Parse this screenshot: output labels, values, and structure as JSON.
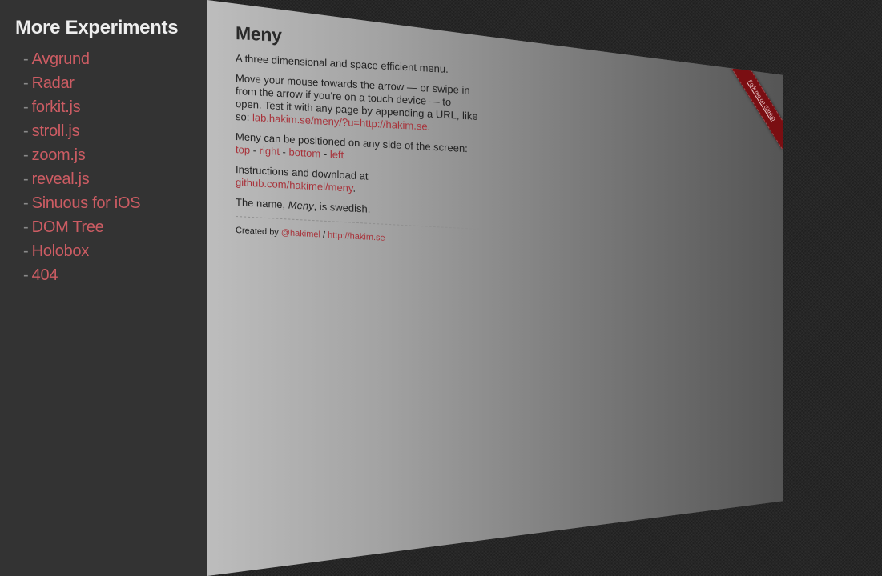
{
  "menu": {
    "title": "More Experiments",
    "dash": "-",
    "items": [
      {
        "label": "Avgrund"
      },
      {
        "label": "Radar"
      },
      {
        "label": "forkit.js"
      },
      {
        "label": "stroll.js"
      },
      {
        "label": "zoom.js"
      },
      {
        "label": "reveal.js"
      },
      {
        "label": "Sinuous for iOS"
      },
      {
        "label": "DOM Tree"
      },
      {
        "label": "Holobox"
      },
      {
        "label": "404"
      }
    ]
  },
  "panel": {
    "title": "Meny",
    "intro": "A three dimensional and space efficient menu.",
    "instructions": "Move your mouse towards the arrow — or swipe in from the arrow if you're on a touch device — to open. Test it with any page by appending a URL, like so:",
    "example_link": "lab.hakim.se/meny/?u=http://hakim.se.",
    "position_text": "Meny can be positioned on any side of the screen:",
    "positions": {
      "top": "top",
      "right": "right",
      "bottom": "bottom",
      "left": "left"
    },
    "position_sep": " - ",
    "download_text": "Instructions and download at",
    "download_link": "github.com/hakimel/meny",
    "download_end": ".",
    "name_prefix": "The name,",
    "name_word": "Meny",
    "name_suffix": ", is swedish.",
    "created_by": "Created by",
    "author_handle": "@hakimel",
    "credit_sep": " / ",
    "author_site": "http://hakim.se"
  },
  "ribbon": {
    "label": "Fork me on GitHub"
  },
  "colors": {
    "link": "#cc5c63",
    "panel_link": "#a8323a",
    "menu_bg": "#333333",
    "ribbon": "#7a0e12"
  }
}
